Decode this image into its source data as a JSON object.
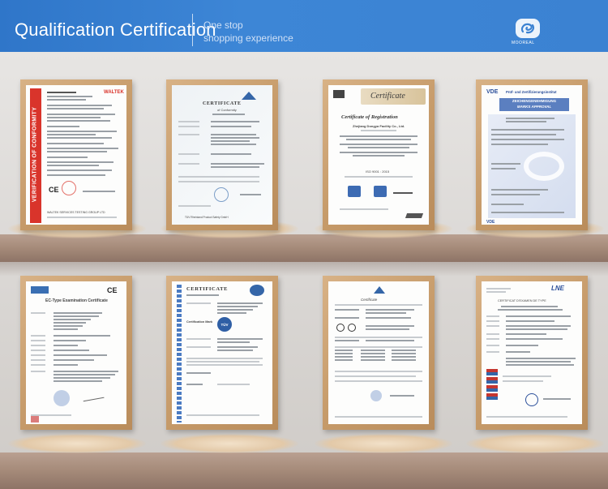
{
  "header": {
    "title": "Qualification Certification",
    "subtitle_line1": "One stop",
    "subtitle_line2": "shopping experience",
    "logo_text": "MOOREAL",
    "background_color": "#3b82d2",
    "logo_icon": "swirl-logo-icon"
  },
  "certificates": {
    "top": [
      {
        "banner": "VERIFICATION OF CONFORMITY",
        "brand": "WALTEK",
        "footer": "WALTEK SERVICES TESTING GROUP LTD",
        "mark": "CE"
      },
      {
        "heading": "CERTIFICATE",
        "subheading": "of Conformity",
        "footer": "TÜV Rheinland Product Safety GmbH"
      },
      {
        "heading": "Certificate",
        "subheading": "Certificate of Registration",
        "company": "Zhejiang Dongya Facility Co., Ltd.",
        "standard": "ISO 9001 : 2015",
        "marks": [
          "IAF",
          "IAF"
        ]
      },
      {
        "brand": "VDE",
        "heading": "Prüf- und Zertifizierungsinstitut",
        "subheading": "ZEICHENGENEHMIGUNG",
        "subheading2": "MARKS APPROVAL"
      }
    ],
    "bottom": [
      {
        "heading": "EC-Type Examination Certificate",
        "mark": "CE"
      },
      {
        "heading": "CERTIFICATE",
        "subheading": "Certification Mark",
        "mark": "TÜV"
      },
      {
        "heading": "Certificate"
      },
      {
        "brand": "LNE",
        "heading": "CERTIFICAT D'EXAMEN DE TYPE"
      }
    ]
  }
}
